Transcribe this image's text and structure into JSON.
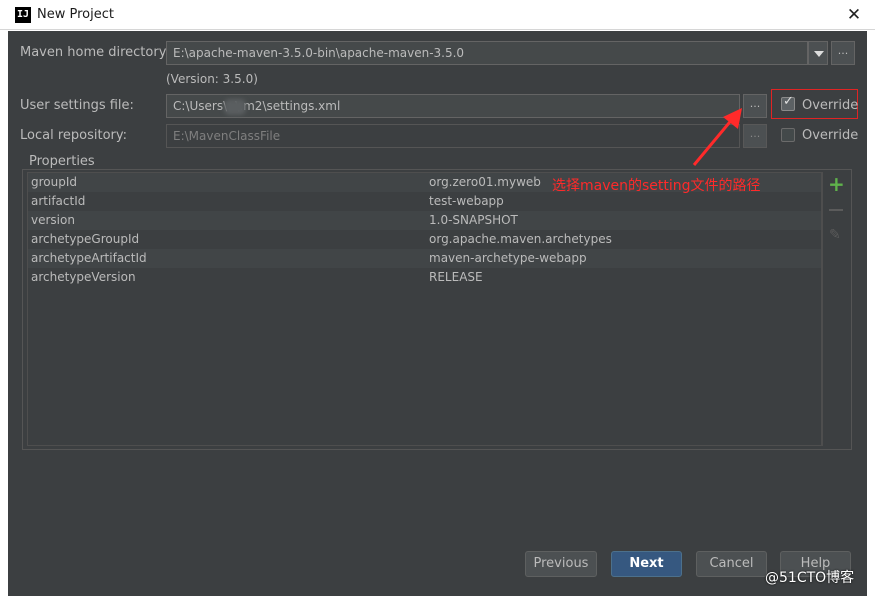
{
  "window": {
    "title": "New Project",
    "close_glyph": "✕",
    "app_icon_text": "IJ"
  },
  "maven_home": {
    "label": "Maven home directory:",
    "value": "E:\\apache-maven-3.5.0-bin\\apache-maven-3.5.0",
    "version_text": "(Version: 3.5.0)",
    "browse_label": "..."
  },
  "user_settings": {
    "label": "User settings file:",
    "value": "C:\\Users\\ -\\.m2\\settings.xml",
    "browse_label": "...",
    "override_label": "Override",
    "override_checked": true
  },
  "local_repo": {
    "label": "Local repository:",
    "value": "E:\\MavenClassFile",
    "browse_label": "...",
    "override_label": "Override",
    "override_checked": false
  },
  "properties": {
    "title": "Properties",
    "rows": [
      {
        "key": "groupId",
        "value": "org.zero01.myweb"
      },
      {
        "key": "artifactId",
        "value": "test-webapp"
      },
      {
        "key": "version",
        "value": "1.0-SNAPSHOT"
      },
      {
        "key": "archetypeGroupId",
        "value": "org.apache.maven.archetypes"
      },
      {
        "key": "archetypeArtifactId",
        "value": "maven-archetype-webapp"
      },
      {
        "key": "archetypeVersion",
        "value": "RELEASE"
      }
    ],
    "toolbar": {
      "add_glyph": "+",
      "edit_glyph": "✎"
    }
  },
  "annotation": {
    "text": "选择maven的setting文件的路径",
    "color": "#ff2a2a"
  },
  "buttons": {
    "previous": "Previous",
    "next": "Next",
    "cancel": "Cancel",
    "help": "Help"
  },
  "watermark": "@51CTO博客",
  "colors": {
    "background": "#3c3f41",
    "primary_button": "#365880",
    "add_icon": "#5fb24b",
    "highlight": "#e02424"
  }
}
